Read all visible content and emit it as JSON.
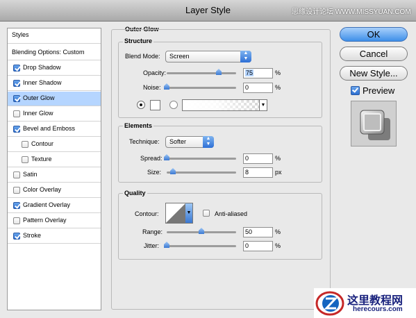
{
  "window": {
    "title": "Layer Style"
  },
  "watermark_top": "思缘设计论坛 WWW.MISSYUAN.COM",
  "left_panel": {
    "header": "Styles",
    "blending": "Blending Options: Custom",
    "items": [
      {
        "label": "Drop Shadow",
        "checked": true
      },
      {
        "label": "Inner Shadow",
        "checked": true
      },
      {
        "label": "Outer Glow",
        "checked": true,
        "selected": true
      },
      {
        "label": "Inner Glow",
        "checked": false
      },
      {
        "label": "Bevel and Emboss",
        "checked": true
      },
      {
        "label": "Contour",
        "checked": false,
        "indent": true
      },
      {
        "label": "Texture",
        "checked": false,
        "indent": true
      },
      {
        "label": "Satin",
        "checked": false
      },
      {
        "label": "Color Overlay",
        "checked": false
      },
      {
        "label": "Gradient Overlay",
        "checked": true
      },
      {
        "label": "Pattern Overlay",
        "checked": false
      },
      {
        "label": "Stroke",
        "checked": true
      }
    ]
  },
  "outer_glow": {
    "title": "Outer Glow",
    "structure": {
      "title": "Structure",
      "blend_mode_label": "Blend Mode:",
      "blend_mode_value": "Screen",
      "opacity_label": "Opacity:",
      "opacity_value": "75",
      "opacity_level": 0.75,
      "noise_label": "Noise:",
      "noise_value": "0",
      "noise_level": 0,
      "unit": "%"
    },
    "elements": {
      "title": "Elements",
      "technique_label": "Technique:",
      "technique_value": "Softer",
      "spread_label": "Spread:",
      "spread_value": "0",
      "spread_unit": "%",
      "size_label": "Size:",
      "size_value": "8",
      "size_unit": "px"
    },
    "quality": {
      "title": "Quality",
      "contour_label": "Contour:",
      "anti_aliased_label": "Anti-aliased",
      "range_label": "Range:",
      "range_value": "50",
      "range_unit": "%",
      "jitter_label": "Jitter:",
      "jitter_value": "0",
      "jitter_unit": "%"
    }
  },
  "buttons": {
    "ok": "OK",
    "cancel": "Cancel",
    "new_style": "New Style...",
    "preview": "Preview",
    "preview_checked": true
  },
  "watermark_logo": {
    "title": "这里教程网",
    "url_text": "herecours.com"
  }
}
